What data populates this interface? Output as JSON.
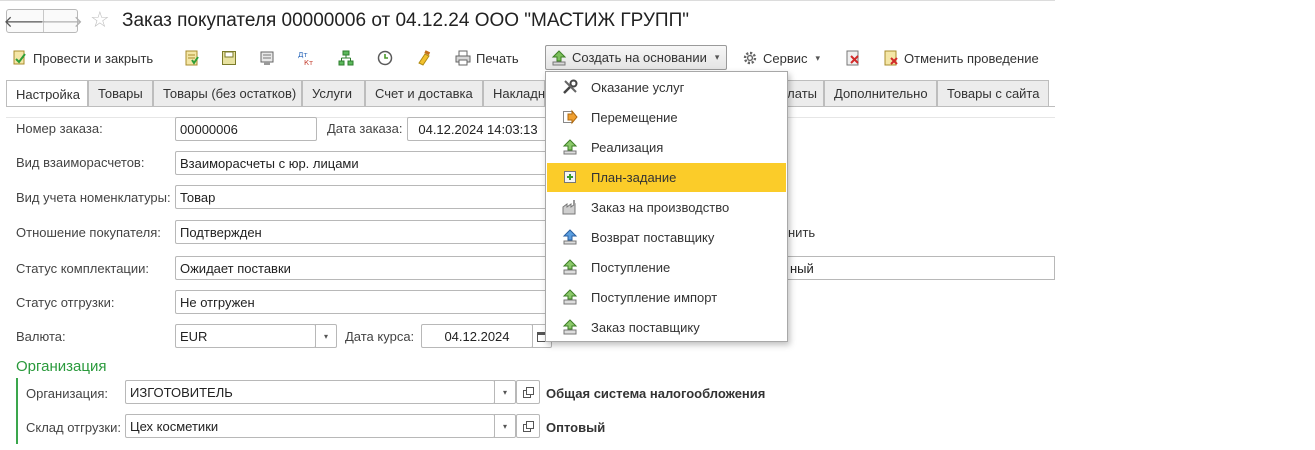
{
  "window": {
    "title": "Заказ покупателя 00000006 от 04.12.24 ООО \"МАСТИЖ ГРУПП\"",
    "back_icon": "arrow-left-icon",
    "forward_icon": "arrow-right-icon",
    "favorite_icon": "star-icon",
    "back_glyph": "🡐",
    "forward_glyph": "🡒",
    "star_glyph": "☆"
  },
  "toolbar": {
    "post_close_label": "Провести и закрыть",
    "print_label": "Печать",
    "create_based_label": "Создать на основании",
    "service_label": "Сервис",
    "unpost_label": "Отменить проведение",
    "dropdown_glyph": "▾"
  },
  "tabs": [
    {
      "label": "Настройка",
      "active": true
    },
    {
      "label": "Товары"
    },
    {
      "label": "Товары (без остатков)"
    },
    {
      "label": "Услуги"
    },
    {
      "label": "Счет и доставка"
    },
    {
      "label": "Накладн"
    },
    {
      "label": "латы"
    },
    {
      "label": "Дополнительно"
    },
    {
      "label": "Товары с сайта"
    }
  ],
  "form": {
    "order_number_label": "Номер заказа:",
    "order_number": "00000006",
    "order_date_label": "Дата заказа:",
    "order_date": "04.12.2024 14:03:13",
    "settlement_label": "Вид взаиморасчетов:",
    "settlement": "Взаиморасчеты с юр. лицами",
    "nomenclature_label": "Вид учета номенклатуры:",
    "nomenclature": "Товар",
    "relation_label": "Отношение покупателя:",
    "relation": "Подтвержден",
    "relation_side": "нить",
    "assembly_label": "Статус комплектации:",
    "assembly": "Ожидает поставки",
    "assembly_side": "ный",
    "shipment_label": "Статус отгрузки:",
    "shipment": "Не отгружен",
    "currency_label": "Валюта:",
    "currency": "EUR",
    "rate_date_label": "Дата курса:",
    "rate_date": "04.12.2024"
  },
  "organization": {
    "section_title": "Организация",
    "org_label": "Организация:",
    "org_value": "ИЗГОТОВИТЕЛЬ",
    "tax_system": "Общая система налогообложения",
    "warehouse_label": "Склад отгрузки:",
    "warehouse_value": "Цех косметики",
    "warehouse_type": "Оптовый"
  },
  "create_menu": {
    "items": [
      {
        "label": "Оказание услуг",
        "icon": "tools-icon"
      },
      {
        "label": "Перемещение",
        "icon": "move-icon"
      },
      {
        "label": "Реализация",
        "icon": "sale-icon"
      },
      {
        "label": "План-задание",
        "icon": "plan-icon",
        "selected": true
      },
      {
        "label": "Заказ на производство",
        "icon": "factory-icon"
      },
      {
        "label": "Возврат поставщику",
        "icon": "return-icon"
      },
      {
        "label": "Поступление",
        "icon": "receipt-icon"
      },
      {
        "label": "Поступление импорт",
        "icon": "receipt-import-icon"
      },
      {
        "label": "Заказ поставщику",
        "icon": "supplier-order-icon"
      }
    ]
  },
  "colors": {
    "accent_green": "#2a9a3c",
    "menu_highlight": "#fbcc29"
  }
}
